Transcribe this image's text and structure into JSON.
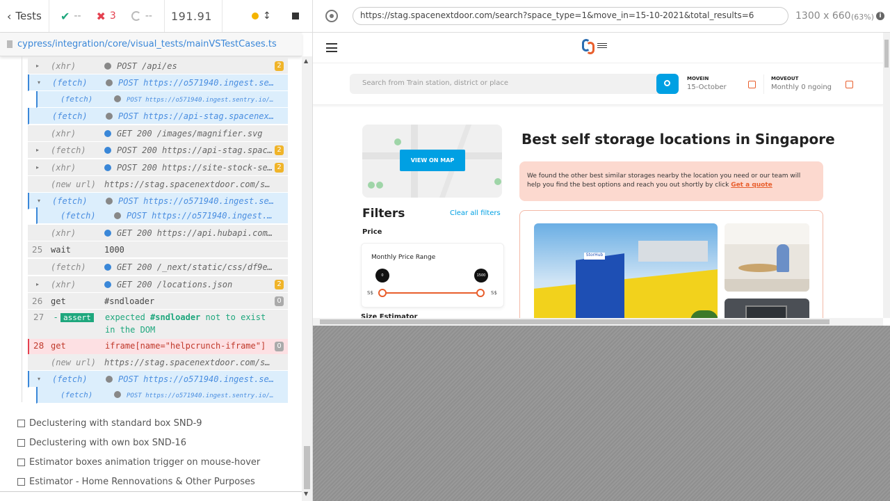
{
  "reporter": {
    "back_label": "Tests",
    "passed": "--",
    "failed": "3",
    "pending": "--",
    "duration": "191.91",
    "spec_path": "cypress/integration/core/visual_tests/mainVSTestCases.ts"
  },
  "commands": [
    {
      "num": "",
      "name": "(xhr)",
      "msg": "POST /api/es",
      "badge": "2",
      "style": "gray",
      "dot": "#888",
      "tri": "▸"
    },
    {
      "num": "",
      "name": "(fetch)",
      "msg": "POST https://o571940.ingest.sentry.io/a...",
      "badge": "",
      "style": "blue",
      "dot": "#888",
      "tri": "▾"
    },
    {
      "num": "",
      "name": "(fetch)",
      "msg": "POST https://o571940.ingest.sentry.io/api/5...",
      "badge": "",
      "style": "blue",
      "dot": "#888",
      "tri": ""
    },
    {
      "num": "",
      "name": "(fetch)",
      "msg": "POST https://api-stag.spacenext...",
      "badge": "",
      "style": "blue",
      "dot": "#888",
      "tri": ""
    },
    {
      "num": "",
      "name": "(xhr)",
      "msg": "GET 200 /images/magnifier.svg",
      "badge": "",
      "style": "gray",
      "dot": "#3a87d8",
      "tri": ""
    },
    {
      "num": "",
      "name": "(fetch)",
      "msg": "POST 200 https://api-stag.spac...",
      "badge": "2",
      "style": "gray",
      "dot": "#3a87d8",
      "tri": "▸"
    },
    {
      "num": "",
      "name": "(xhr)",
      "msg": "POST 200 https://site-stock-ser...",
      "badge": "2",
      "style": "gray",
      "dot": "#3a87d8",
      "tri": "▸"
    },
    {
      "num": "",
      "name": "(new url)",
      "msg": "https://stag.spacenextdoor.com/sea...",
      "badge": "",
      "style": "gray",
      "dot": "",
      "tri": ""
    },
    {
      "num": "",
      "name": "(fetch)",
      "msg": "POST https://o571940.ingest.sentry.io/a...",
      "badge": "",
      "style": "blue",
      "dot": "#888",
      "tri": "▾"
    },
    {
      "num": "",
      "name": "(fetch)",
      "msg": "POST https://o571940.ingest.sentry.io/api/5...",
      "badge": "",
      "style": "blue",
      "dot": "#888",
      "tri": ""
    },
    {
      "num": "",
      "name": "(xhr)",
      "msg": "GET 200 https://api.hubapi.com/...",
      "badge": "",
      "style": "gray",
      "dot": "#3a87d8",
      "tri": ""
    },
    {
      "num": "25",
      "name": "wait",
      "msg": "1000",
      "badge": "",
      "style": "gray",
      "dot": "",
      "tri": ""
    },
    {
      "num": "",
      "name": "(fetch)",
      "msg": "GET 200 /_next/static/css/df9e9...",
      "badge": "",
      "style": "gray",
      "dot": "#3a87d8",
      "tri": ""
    },
    {
      "num": "",
      "name": "(xhr)",
      "msg": "GET 200 /locations.json",
      "badge": "2",
      "style": "gray",
      "dot": "#3a87d8",
      "tri": "▸"
    },
    {
      "num": "26",
      "name": "get",
      "msg": "#sndloader",
      "badge": "0",
      "style": "gray",
      "dot": "",
      "tri": ""
    }
  ],
  "assert_row": {
    "num": "27",
    "tag": "assert",
    "text1": "expected",
    "target": "#sndloader",
    "text2": "not to exist",
    "text3": "in the DOM"
  },
  "failed_row": {
    "num": "28",
    "name": "get",
    "msg": "iframe[name=\"helpcrunch-iframe\"]",
    "badge": "0"
  },
  "tail_commands": [
    {
      "name": "(new url)",
      "msg": "https://stag.spacenextdoor.com/sea...",
      "style": "gray",
      "tri": ""
    },
    {
      "name": "(fetch)",
      "msg": "POST https://o571940.ingest.sentry.io/a...",
      "style": "blue",
      "tri": "▾"
    },
    {
      "name": "(fetch)",
      "msg": "POST https://o571940.ingest.sentry.io/api/5...",
      "style": "blue",
      "tri": ""
    }
  ],
  "tests": [
    "Declustering with standard box SND-9",
    "Declustering with own box SND-16",
    "Estimator boxes animation trigger on mouse-hover",
    "Estimator - Home Rennovations & Other Purposes"
  ],
  "aut": {
    "url": "https://stag.spacenextdoor.com/search?space_type=1&move_in=15-10-2021&total_results=6",
    "viewport": "1300 x 660",
    "scale": "(63%)"
  },
  "site": {
    "search_placeholder": "Search from Train station, district or place",
    "movein_label": "MOVEIN",
    "movein_value": "15-October",
    "moveout_label": "MOVEOUT",
    "moveout_value": "Monthly 0 ngoing",
    "view_on_map": "VIEW ON MAP",
    "heading": "Best self storage locations in Singapore",
    "notice": "We found the other best similar storages nearby the location you need or our team will help you find the best options and reach you out shortly by click",
    "notice_link": "Get a quote",
    "filters_title": "Filters",
    "clear_filters": "Clear all filters",
    "price_label": "Price",
    "monthly_range": "Monthly Price Range",
    "min_value": "0",
    "max_value": "1500",
    "currency": "S$",
    "size_estimator": "Size Estimator",
    "brand_color": "#e85e2c",
    "accent_blue": "#00a0e3"
  }
}
